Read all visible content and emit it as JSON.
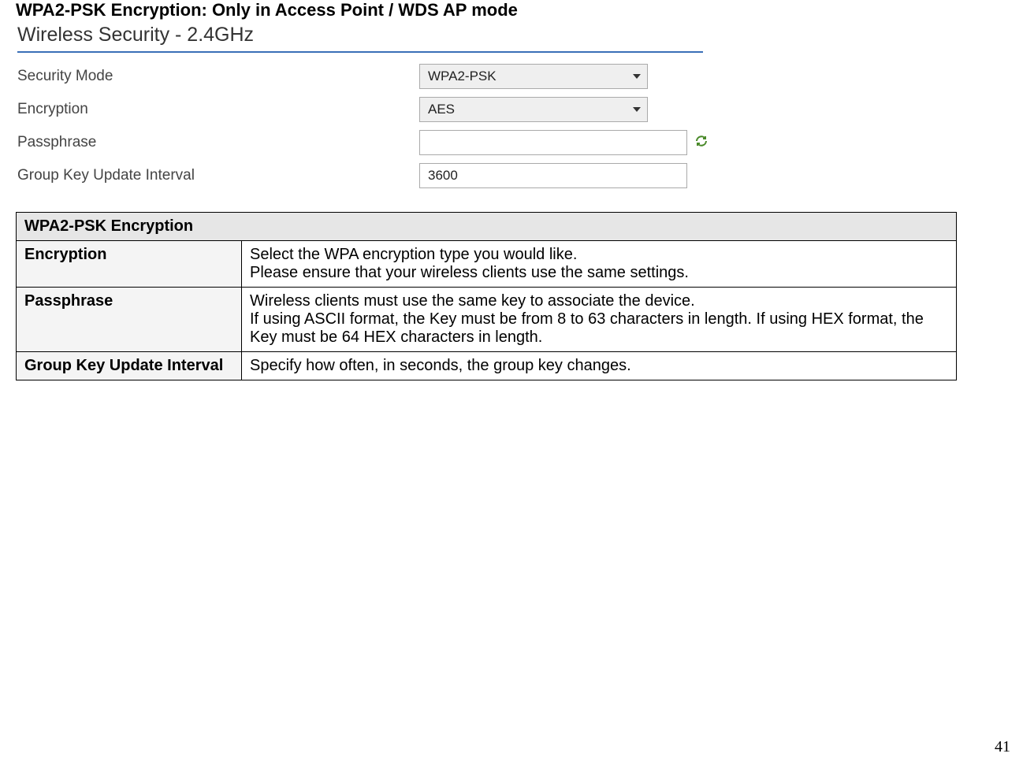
{
  "heading": "WPA2-PSK Encryption: Only in Access Point / WDS AP mode",
  "subheading": "Wireless Security - 2.4GHz",
  "form": {
    "security_mode": {
      "label": "Security Mode",
      "value": "WPA2-PSK"
    },
    "encryption": {
      "label": "Encryption",
      "value": "AES"
    },
    "passphrase": {
      "label": "Passphrase",
      "value": ""
    },
    "group_key": {
      "label": "Group Key Update Interval",
      "value": "3600"
    }
  },
  "table": {
    "title": "WPA2-PSK Encryption",
    "rows": [
      {
        "field": "Encryption",
        "desc": "Select the WPA encryption type you would like.\nPlease ensure that your wireless clients use the same settings."
      },
      {
        "field": "Passphrase",
        "desc": "Wireless clients must use the same key to associate the device.\nIf using ASCII format, the Key must be from 8 to 63 characters in length. If using HEX format, the Key must be 64 HEX characters in length."
      },
      {
        "field": "Group Key Update Interval",
        "desc": "Specify how often, in seconds, the group key changes."
      }
    ]
  },
  "page_number": "41"
}
